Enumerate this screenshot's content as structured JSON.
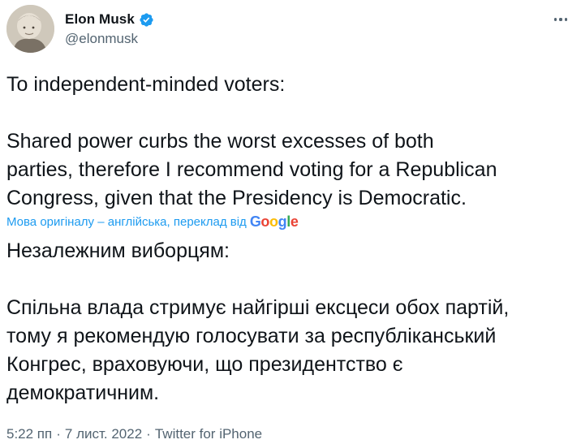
{
  "author": {
    "display_name": "Elon Musk",
    "handle": "@elonmusk",
    "verified_icon": "verified-badge-icon",
    "avatar_icon": "avatar-photo",
    "more_icon": "more-options-icon"
  },
  "tweet": {
    "text": "To independent-minded voters:\n\nShared power curbs the worst excesses of both\nparties, therefore I recommend voting for a Republican\nCongress, given that the Presidency is Democratic."
  },
  "translation": {
    "note": "Мова оригіналу – англійська, переклад від",
    "provider": "Google",
    "text": "Незалежним виборцям:\n\nСпільна влада стримує найгірші ексцеси обох партій,\nтому я рекомендую голосувати за республіканський\nКонгрес, враховуючи, що президентство є\nдемократичним."
  },
  "meta": {
    "time": "5:22 пп",
    "sep1": "·",
    "date": "7 лист. 2022",
    "sep2": "·",
    "source": "Twitter for iPhone"
  },
  "colors": {
    "text": "#0f1419",
    "secondary": "#536471",
    "accent": "#1d9bf0"
  }
}
